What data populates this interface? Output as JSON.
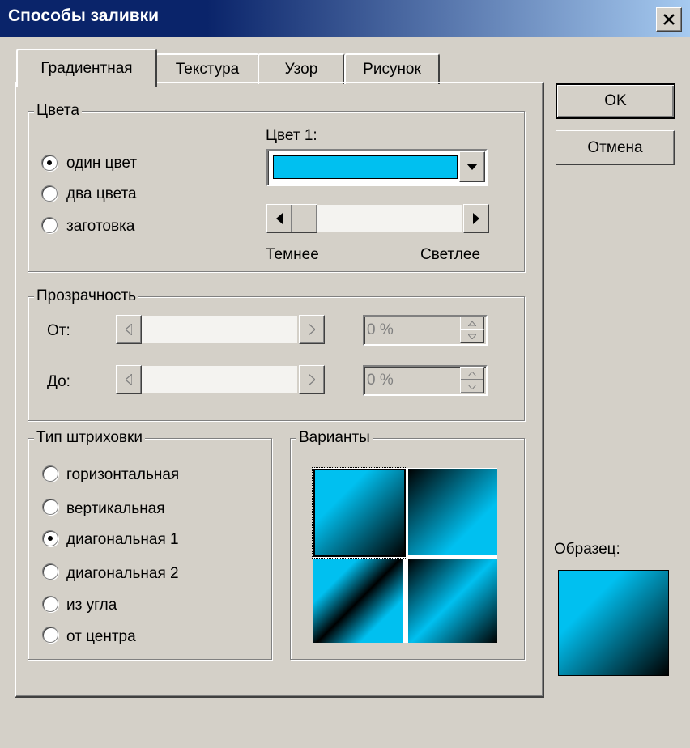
{
  "window": {
    "title": "Способы заливки"
  },
  "tabs": [
    {
      "label": "Градиентная",
      "active": true
    },
    {
      "label": "Текстура",
      "active": false
    },
    {
      "label": "Узор",
      "active": false
    },
    {
      "label": "Рисунок",
      "active": false
    }
  ],
  "buttons": {
    "ok": "OK",
    "cancel": "Отмена"
  },
  "colors_group": {
    "legend": "Цвета",
    "options": [
      {
        "label": "один цвет",
        "checked": true
      },
      {
        "label": "два цвета",
        "checked": false
      },
      {
        "label": "заготовка",
        "checked": false
      }
    ],
    "color1_label": "Цвет 1:",
    "color1_value": "#00c0f0",
    "darker_label": "Темнее",
    "lighter_label": "Светлее"
  },
  "transparency_group": {
    "legend": "Прозрачность",
    "from_label": "От:",
    "to_label": "До:",
    "from_value": "0 %",
    "to_value": "0 %"
  },
  "shading_group": {
    "legend": "Тип штриховки",
    "options": [
      {
        "label": "горизонтальная",
        "checked": false
      },
      {
        "label": "вертикальная",
        "checked": false
      },
      {
        "label": "диагональная 1",
        "checked": true
      },
      {
        "label": "диагональная 2",
        "checked": false
      },
      {
        "label": "из угла",
        "checked": false
      },
      {
        "label": "от центра",
        "checked": false
      }
    ]
  },
  "variants_group": {
    "legend": "Варианты"
  },
  "sample": {
    "label": "Образец:"
  },
  "accent": {
    "cyan": "#00c0f0",
    "titlebar": "#0a246a"
  }
}
